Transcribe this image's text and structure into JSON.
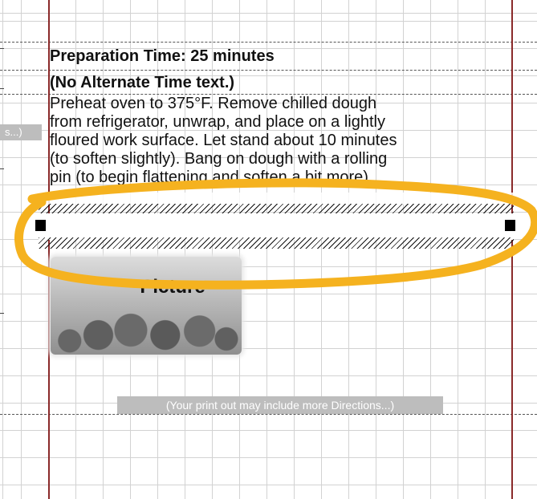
{
  "section": {
    "title": "Preparation Time: 25 minutes",
    "subtitle": "(No Alternate Time text.)",
    "body_lines": [
      "Preheat oven to 375°F. Remove chilled dough",
      "from refrigerator, unwrap, and place on a lightly",
      "floured work surface. Let stand about 10 minutes",
      "(to soften slightly). Bang on dough with a rolling",
      "pin (to begin flattening and soften a bit more)."
    ]
  },
  "margin_tag": "s...)",
  "picture": {
    "label": "Picture"
  },
  "note": "(Your print out may include more Directions...)",
  "colors": {
    "highlight": "#f5b21f",
    "margin_rule": "#8a2a2a",
    "grid": "#d2d2d2",
    "note_bg": "#bdbdbd"
  }
}
